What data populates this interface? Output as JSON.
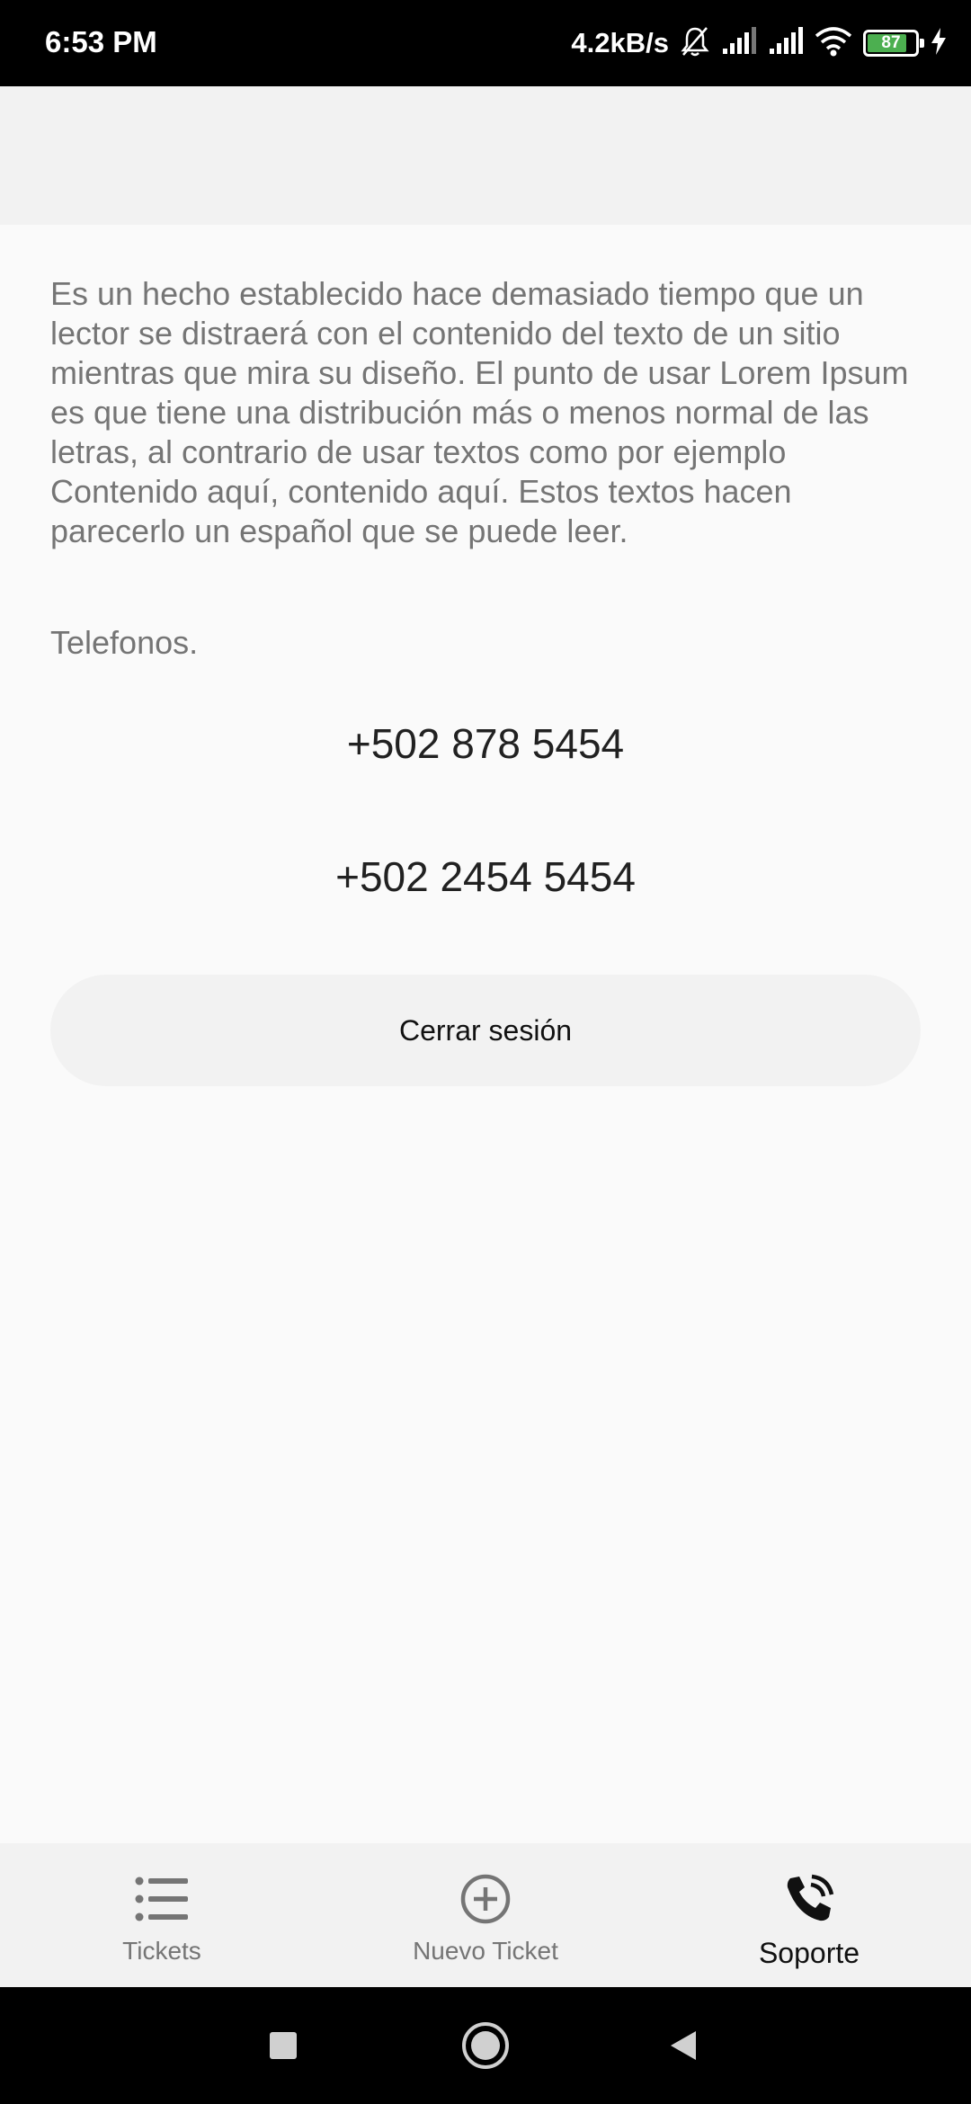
{
  "status_bar": {
    "time": "6:53 PM",
    "network_speed": "4.2kB/s",
    "battery_level": "87",
    "icons": [
      "mute-bell-icon",
      "signal-icon",
      "signal-icon",
      "wifi-icon",
      "battery-icon",
      "charging-icon"
    ]
  },
  "content": {
    "description": "Es un hecho establecido hace demasiado tiempo que un lector se distraerá con el contenido del texto de un sitio mientras que mira su diseño. El punto de usar Lorem Ipsum es que tiene una distribución más o menos normal de las letras, al contrario de usar textos como por ejemplo Contenido aquí, contenido aquí. Estos textos hacen parecerlo un español que se puede leer.",
    "phones_heading": "Telefonos.",
    "phones": [
      "+502 878 5454",
      "+502 2454 5454"
    ],
    "logout_label": "Cerrar sesión"
  },
  "bottom_nav": {
    "items": [
      {
        "label": "Tickets",
        "icon": "list-icon",
        "active": false
      },
      {
        "label": "Nuevo Ticket",
        "icon": "add-circle-icon",
        "active": false
      },
      {
        "label": "Soporte",
        "icon": "phone-call-icon",
        "active": true
      }
    ]
  },
  "system_nav": {
    "icons": [
      "recents-square-icon",
      "home-circle-icon",
      "back-triangle-icon"
    ]
  },
  "colors": {
    "background": "#fafafa",
    "header": "#f2f2f2",
    "body_text": "#757575",
    "phone_text": "#212121",
    "battery_fill": "#4caf50"
  }
}
